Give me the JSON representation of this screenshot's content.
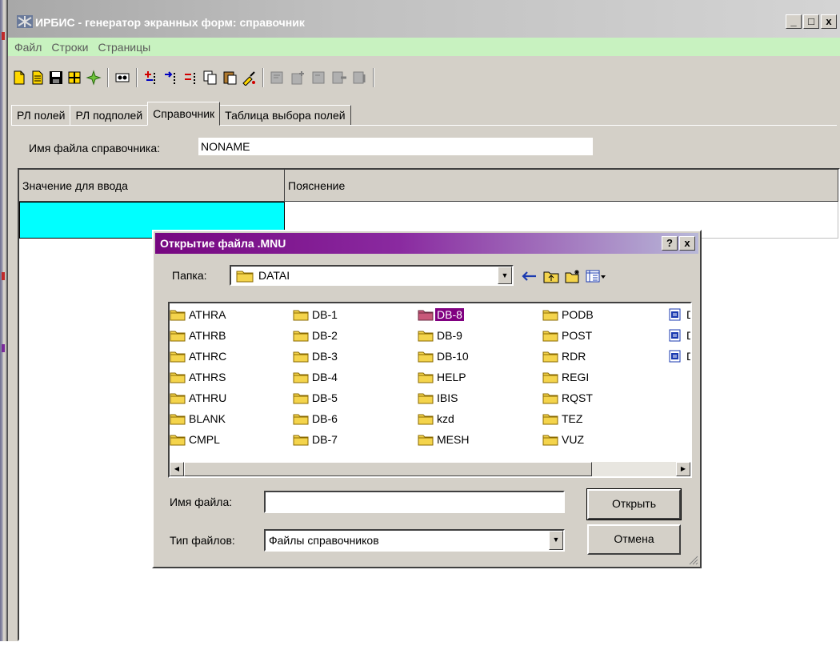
{
  "window": {
    "title": "ИРБИС - генератор экранных форм: справочник",
    "controls": [
      "_",
      "□",
      "x"
    ]
  },
  "menu": [
    "Файл",
    "Строки",
    "Страницы"
  ],
  "tabs": [
    {
      "label": "РЛ полей",
      "active": false
    },
    {
      "label": "РЛ подполей",
      "active": false
    },
    {
      "label": "Справочник",
      "active": true
    },
    {
      "label": "Таблица выбора полей",
      "active": false
    }
  ],
  "form": {
    "file_label": "Имя файла справочника:",
    "file_value": "NONAME"
  },
  "grid": {
    "columns": [
      "Значение для ввода",
      "Пояснение"
    ],
    "selected_color": "#00ffff"
  },
  "dialog": {
    "title": "Открытие файла .MNU",
    "help_btn": "?",
    "close_btn": "x",
    "folder_label": "Папка:",
    "folder_value": "DATAI",
    "columns": [
      [
        "ATHRA",
        "ATHRB",
        "ATHRC",
        "ATHRS",
        "ATHRU",
        "BLANK",
        "CMPL"
      ],
      [
        "DB-1",
        "DB-2",
        "DB-3",
        "DB-4",
        "DB-5",
        "DB-6",
        "DB-7"
      ],
      [
        "DB-8",
        "DB-9",
        "DB-10",
        "HELP",
        "IBIS",
        "kzd",
        "MESH"
      ],
      [
        "PODB",
        "POST",
        "RDR",
        "REGI",
        "RQST",
        "TEZ",
        "VUZ"
      ],
      [
        "D",
        "D",
        "D"
      ]
    ],
    "selected": "DB-8",
    "filename_label": "Имя файла:",
    "filename_value": "",
    "filetype_label": "Тип файлов:",
    "filetype_value": "Файлы справочников",
    "open_btn": "Открыть",
    "cancel_btn": "Отмена"
  },
  "colors": {
    "menubar": "#c8f2c0",
    "dialog_title": "#760680",
    "selection": "#800080"
  }
}
